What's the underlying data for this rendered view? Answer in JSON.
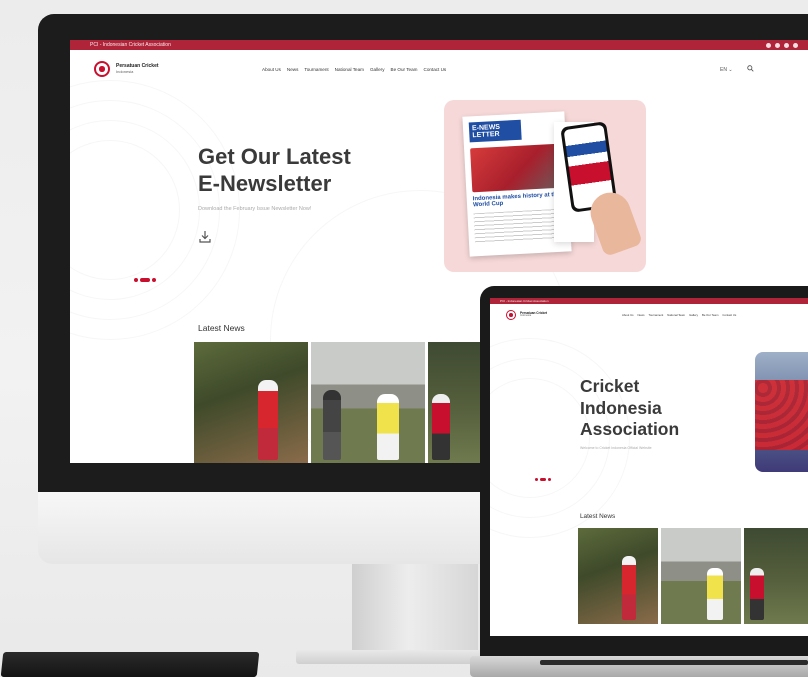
{
  "desktop": {
    "announcement": "PCI - Indonesian Cricket Association",
    "logo": {
      "name": "Persatuan Cricket",
      "sub": "Indonesia"
    },
    "nav": [
      "About Us",
      "News",
      "Tournament",
      "National Team",
      "Gallery",
      "Be Our Team",
      "Contact Us"
    ],
    "language": "EN",
    "hero_title": "Get Our Latest E-Newsletter",
    "hero_title_line1": "Get Our Latest",
    "hero_title_line2": "E-Newsletter",
    "hero_subtitle": "Download the February Issue Newsletter Now!",
    "newsletter": {
      "masthead": "E-NEWS LETTER",
      "headline": "Indonesia makes history at the World Cup"
    },
    "latest_news_heading": "Latest News"
  },
  "laptop": {
    "announcement": "PCI - Indonesian Cricket Association",
    "logo": {
      "name": "Persatuan Cricket",
      "sub": "Indonesia"
    },
    "nav": [
      "About Us",
      "News",
      "Tournament",
      "National Team",
      "Gallery",
      "Be Our Team",
      "Contact Us"
    ],
    "hero_title_line1": "Cricket",
    "hero_title_line2": "Indonesia",
    "hero_title_line3": "Association",
    "hero_subtitle": "Welcome to Cricket Indonesia Official Website",
    "latest_news_heading": "Latest News"
  },
  "colors": {
    "brand_red": "#b0243a",
    "accent_red": "#c8102e",
    "card_pink": "#f6d8d8",
    "heading_text": "#3a3a3a"
  },
  "icons": [
    "instagram-icon",
    "facebook-icon",
    "youtube-icon",
    "twitter-icon",
    "search-icon",
    "chevron-down-icon",
    "download-icon"
  ]
}
